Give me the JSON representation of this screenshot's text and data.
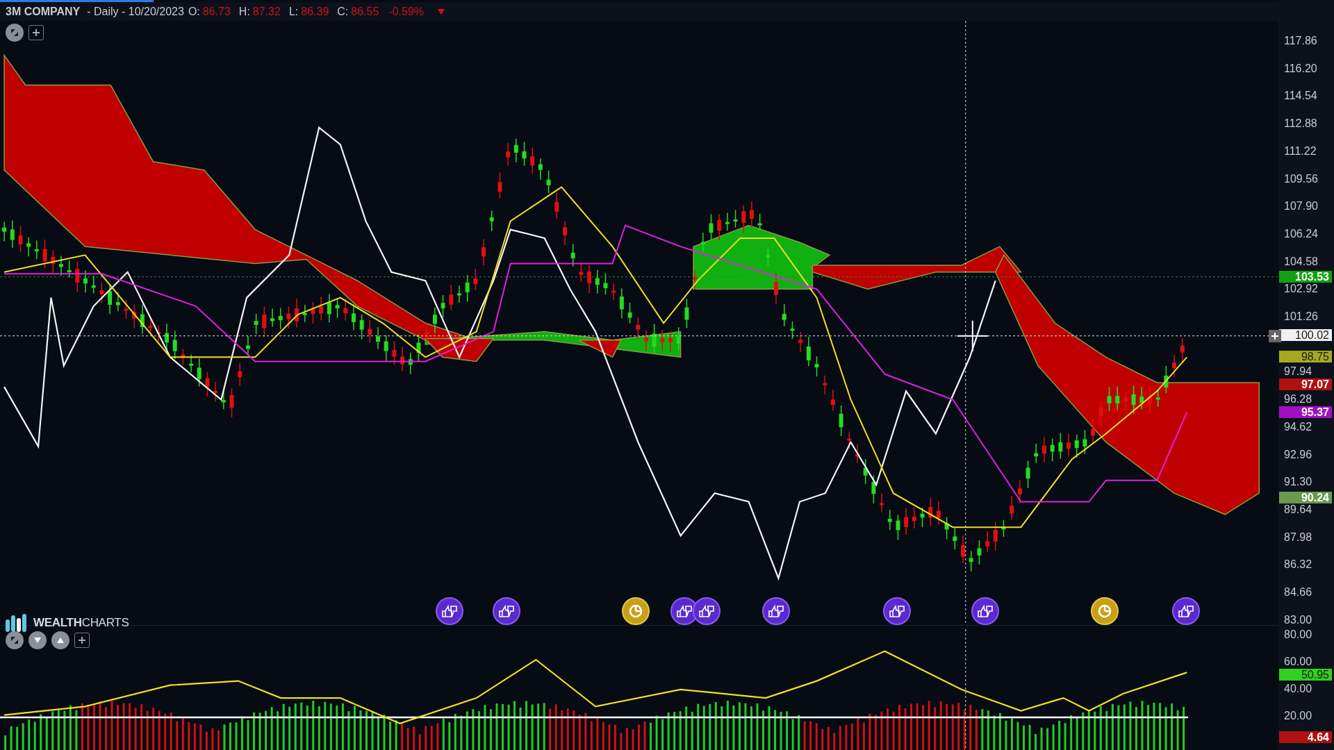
{
  "loading_bar": {
    "level": 0.12
  },
  "header": {
    "symbol": "3M COMPANY",
    "period": "- Daily - 10/20/2023",
    "quotes": [
      {
        "label": "O:",
        "value": "86.73"
      },
      {
        "label": "H:",
        "value": "87.32"
      },
      {
        "label": "L:",
        "value": "86.39"
      },
      {
        "label": "C:",
        "value": "86.55"
      }
    ],
    "change": "-0.59%"
  },
  "logo": {
    "text": "**WEALTH**CHARTS"
  },
  "price_axis": {
    "ticks": [
      "117.86",
      "116.20",
      "114.54",
      "112.88",
      "111.22",
      "109.56",
      "107.90",
      "106.24",
      "104.58",
      "102.92",
      "101.26",
      "97.94",
      "96.28",
      "94.62",
      "92.96",
      "91.30",
      "89.64",
      "87.98",
      "86.32",
      "84.66",
      "83.00"
    ],
    "tags": [
      {
        "value": "103.53",
        "color": "#10a010"
      },
      {
        "value": "100.02",
        "color": "#f0f0f0"
      },
      {
        "value": "98.75",
        "color": "#a8a820"
      },
      {
        "value": "97.07",
        "color": "#b01010"
      },
      {
        "value": "95.37",
        "color": "#a010c0"
      },
      {
        "value": "90.24",
        "color": "#6a9a50"
      }
    ]
  },
  "indicator_axis": {
    "ticks": [
      "80.00",
      "60.00",
      "40.00",
      "20.00"
    ],
    "tags": [
      {
        "value": "50.95",
        "color": "#30d020"
      },
      {
        "value": "4.64",
        "color": "#b01010"
      }
    ]
  },
  "events": [
    {
      "kind": "vote"
    },
    {
      "kind": "vote"
    },
    {
      "kind": "clock"
    },
    {
      "kind": "vote"
    },
    {
      "kind": "vote"
    },
    {
      "kind": "vote"
    },
    {
      "kind": "vote"
    },
    {
      "kind": "vote"
    },
    {
      "kind": "clock"
    },
    {
      "kind": "vote"
    }
  ]
}
